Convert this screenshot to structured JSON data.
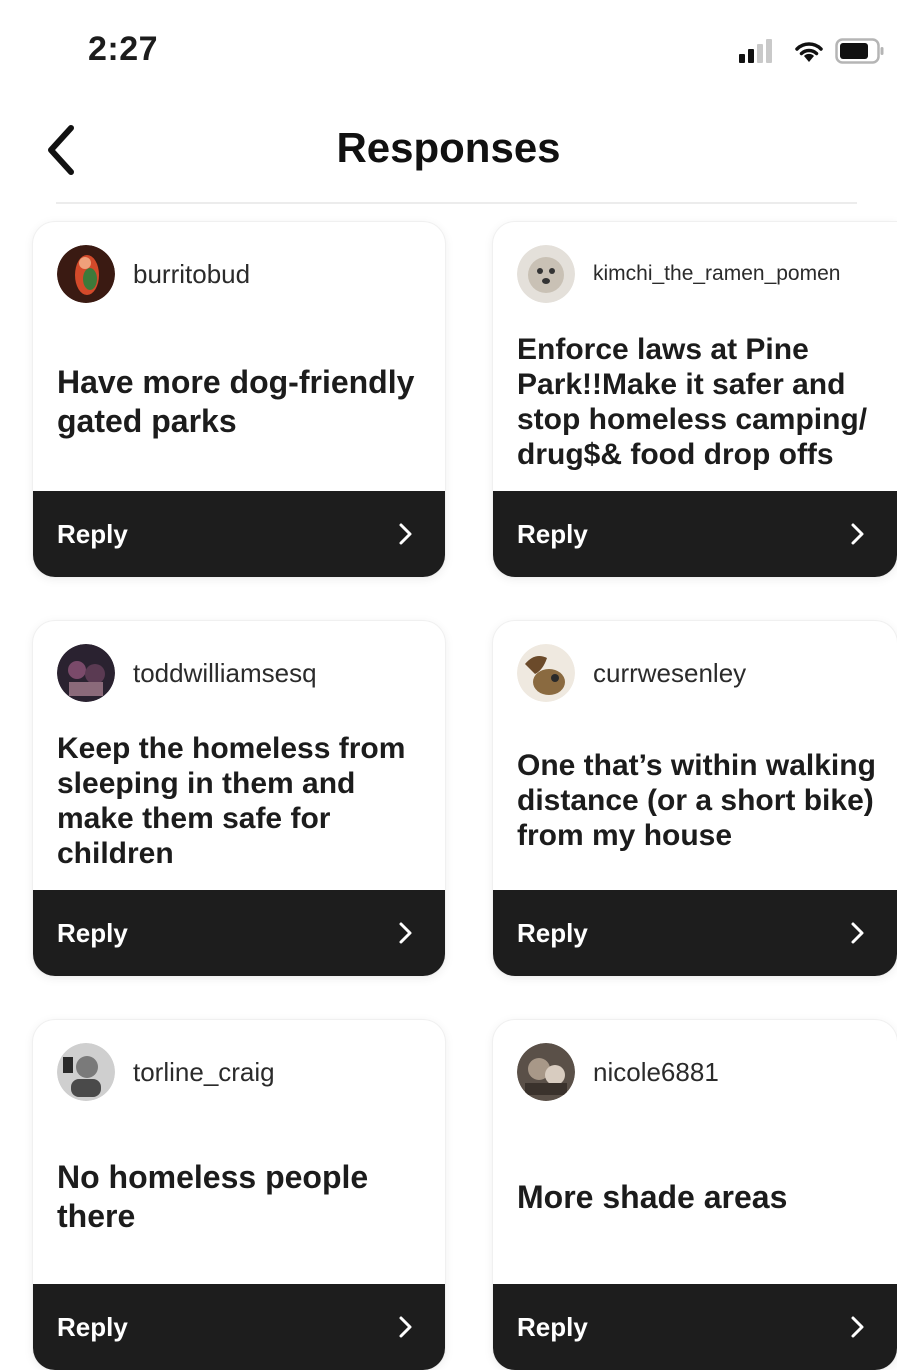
{
  "status": {
    "time": "2:27"
  },
  "nav": {
    "title": "Responses"
  },
  "responses": [
    {
      "username": "burritobud",
      "text": "Have more dog-friendly gated parks",
      "reply_label": "Reply"
    },
    {
      "username": "kimchi_the_ramen_pomen",
      "text": "Enforce laws at Pine Park!!Make it safer and stop homeless camping/ drug$& food drop offs",
      "reply_label": "Reply"
    },
    {
      "username": "toddwilliamsesq",
      "text": "Keep the homeless from sleeping in them and make them safe for children",
      "reply_label": "Reply"
    },
    {
      "username": "currwesenley",
      "text": "One that’s within walking distance (or a short bike) from my house",
      "reply_label": "Reply"
    },
    {
      "username": "torline_craig",
      "text": "No homeless people there",
      "reply_label": "Reply"
    },
    {
      "username": "nicole6881",
      "text": "More shade areas",
      "reply_label": "Reply"
    }
  ],
  "colors": {
    "reply_bar": "#1d1d1d",
    "card_bg": "#ffffff",
    "text": "#1c1c1c"
  },
  "icons": {
    "back": "chevron-left-icon",
    "reply": "chevron-right-icon",
    "signal": "cellular-signal-icon",
    "wifi": "wifi-icon",
    "battery": "battery-icon"
  }
}
